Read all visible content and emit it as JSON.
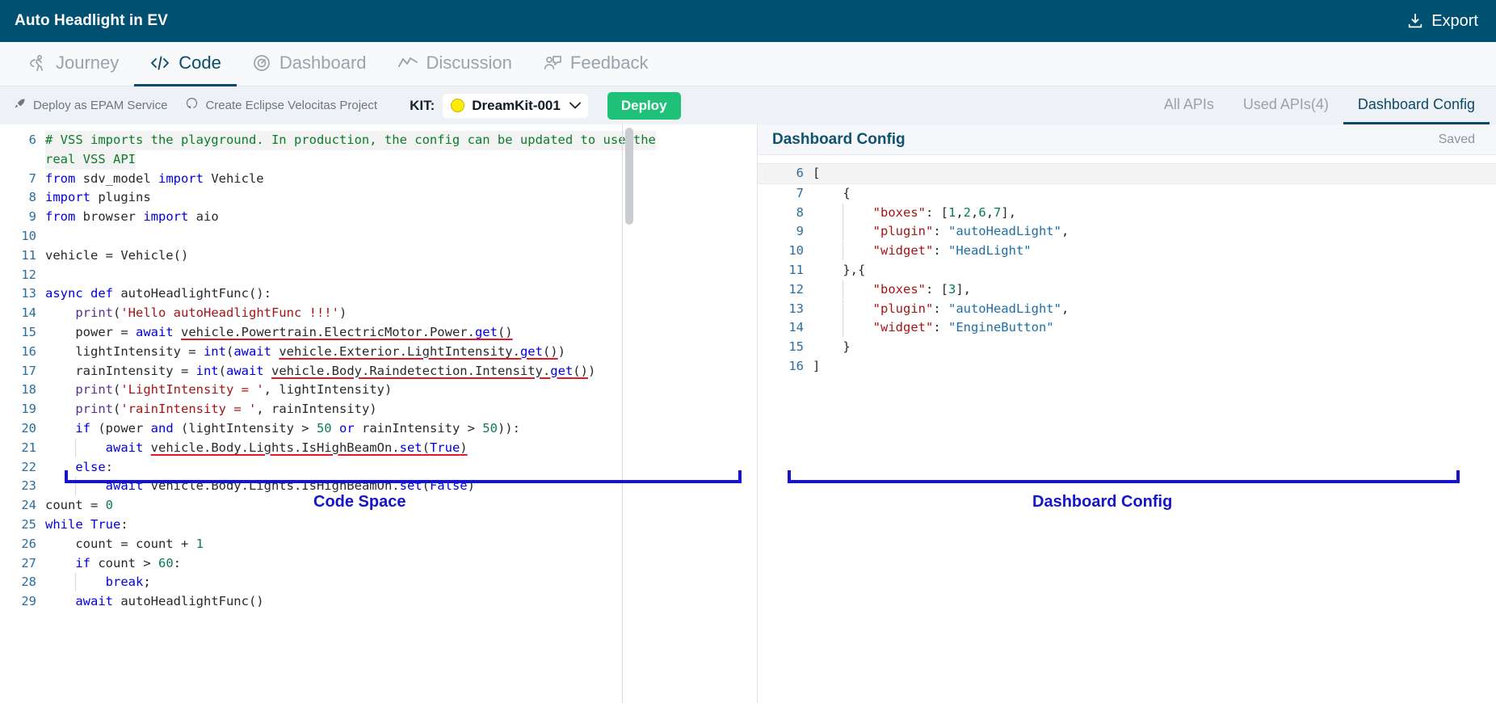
{
  "topbar": {
    "title": "Auto Headlight in EV",
    "export_label": "Export",
    "export_icon": "download-icon"
  },
  "nav": {
    "tabs": [
      {
        "label": "Journey",
        "icon": "journey-icon",
        "active": false
      },
      {
        "label": "Code",
        "icon": "code-icon",
        "active": true
      },
      {
        "label": "Dashboard",
        "icon": "gauge-icon",
        "active": false
      },
      {
        "label": "Discussion",
        "icon": "activity-icon",
        "active": false
      },
      {
        "label": "Feedback",
        "icon": "feedback-icon",
        "active": false
      }
    ]
  },
  "toolbar": {
    "deploy_epam_label": "Deploy as EPAM Service",
    "deploy_epam_icon": "rocket-icon",
    "velocitas_label": "Create Eclipse Velocitas Project",
    "velocitas_icon": "github-icon",
    "kit_label": "KIT:",
    "kit_selected": "DreamKit-001",
    "kit_dot_color": "#ffeb00",
    "chevron_icon": "chevron-down-icon",
    "deploy_button": "Deploy",
    "deploy_button_color": "#1ec177",
    "api_tabs": [
      {
        "label": "All APIs",
        "active": false
      },
      {
        "label": "Used APIs(4)",
        "active": false
      },
      {
        "label": "Dashboard Config",
        "active": true
      }
    ]
  },
  "code_panel": {
    "lines": [
      {
        "num": "6",
        "text": "# VSS imports the playground. In production, the config can be updated to use the"
      },
      {
        "num": "",
        "text": "real VSS API"
      },
      {
        "num": "7",
        "text": "from sdv_model import Vehicle"
      },
      {
        "num": "8",
        "text": "import plugins"
      },
      {
        "num": "9",
        "text": "from browser import aio"
      },
      {
        "num": "10",
        "text": ""
      },
      {
        "num": "11",
        "text": "vehicle = Vehicle()"
      },
      {
        "num": "12",
        "text": ""
      },
      {
        "num": "13",
        "text": "async def autoHeadlightFunc():"
      },
      {
        "num": "14",
        "text": "    print('Hello autoHeadlightFunc !!!')"
      },
      {
        "num": "15",
        "text": "    power = await vehicle.Powertrain.ElectricMotor.Power.get()"
      },
      {
        "num": "16",
        "text": "    lightIntensity = int(await vehicle.Exterior.LightIntensity.get())"
      },
      {
        "num": "17",
        "text": "    rainIntensity = int(await vehicle.Body.Raindetection.Intensity.get())"
      },
      {
        "num": "18",
        "text": "    print('LightIntensity = ', lightIntensity)"
      },
      {
        "num": "19",
        "text": "    print('rainIntensity = ', rainIntensity)"
      },
      {
        "num": "20",
        "text": "    if (power and (lightIntensity > 50 or rainIntensity > 50)):"
      },
      {
        "num": "21",
        "text": "        await vehicle.Body.Lights.IsHighBeamOn.set(True)"
      },
      {
        "num": "22",
        "text": "    else:"
      },
      {
        "num": "23",
        "text": "        await vehicle.Body.Lights.IsHighBeamOn.set(False)"
      },
      {
        "num": "24",
        "text": "count = 0"
      },
      {
        "num": "25",
        "text": "while True:"
      },
      {
        "num": "26",
        "text": "    count = count + 1"
      },
      {
        "num": "27",
        "text": "    if count > 60:"
      },
      {
        "num": "28",
        "text": "        break;"
      },
      {
        "num": "29",
        "text": "    await autoHeadlightFunc()"
      }
    ]
  },
  "dashboard_panel": {
    "header_title": "Dashboard Config",
    "saved_status": "Saved",
    "lines": [
      {
        "num": "6",
        "text": "["
      },
      {
        "num": "7",
        "text": "    {"
      },
      {
        "num": "8",
        "text": "        \"boxes\": [1,2,6,7],"
      },
      {
        "num": "9",
        "text": "        \"plugin\": \"autoHeadLight\","
      },
      {
        "num": "10",
        "text": "        \"widget\": \"HeadLight\""
      },
      {
        "num": "11",
        "text": "    },{"
      },
      {
        "num": "12",
        "text": "        \"boxes\": [3],"
      },
      {
        "num": "13",
        "text": "        \"plugin\": \"autoHeadLight\","
      },
      {
        "num": "14",
        "text": "        \"widget\": \"EngineButton\""
      },
      {
        "num": "15",
        "text": "    }"
      },
      {
        "num": "16",
        "text": "]"
      }
    ]
  },
  "annotations": {
    "color": "#1414cc",
    "left_label": "Code Space",
    "right_label": "Dashboard Config"
  }
}
